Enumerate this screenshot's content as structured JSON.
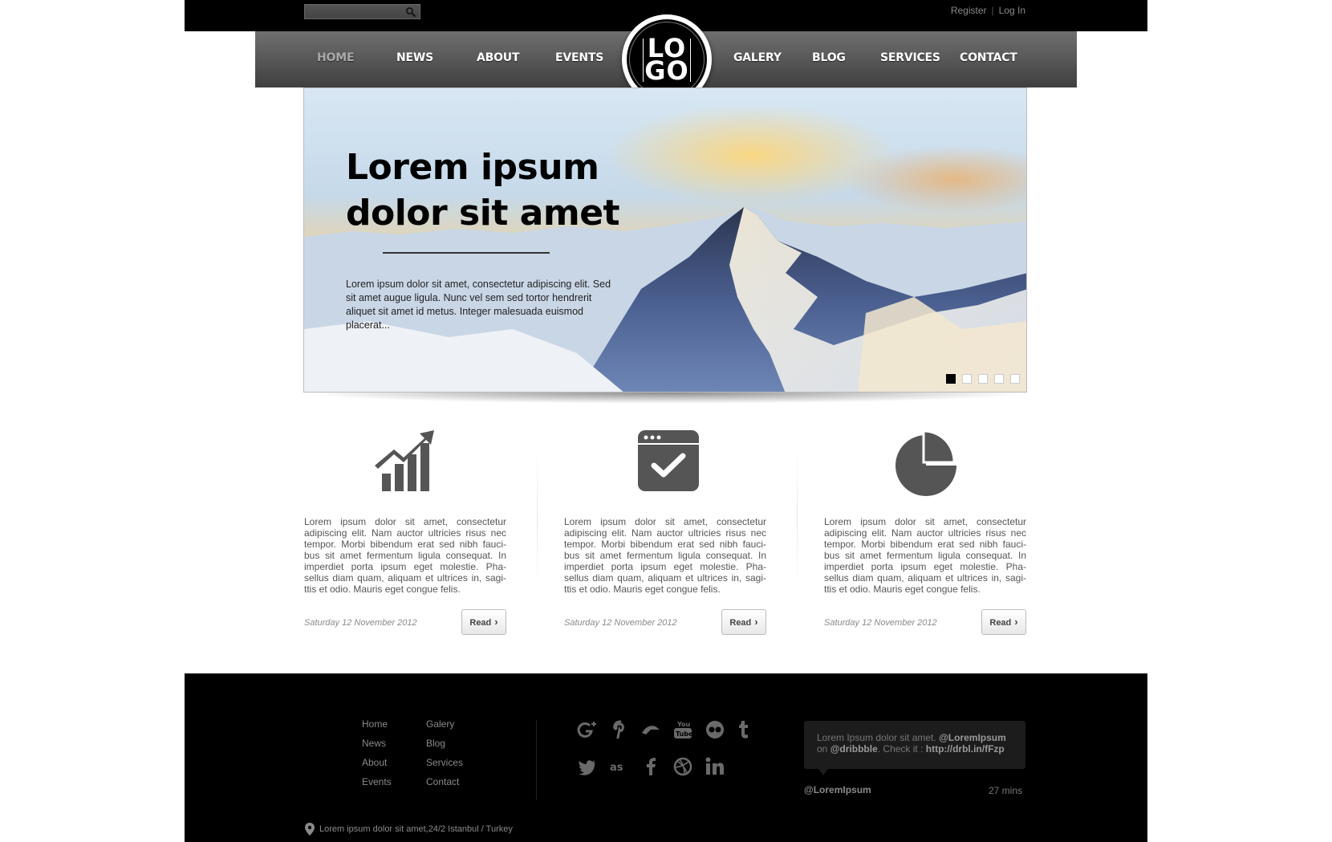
{
  "topbar": {
    "search_placeholder": "",
    "register_label": "Register",
    "separator": "|",
    "login_label": "Log In"
  },
  "nav": {
    "items": [
      {
        "label": "HOME",
        "active": true
      },
      {
        "label": "NEWS"
      },
      {
        "label": "ABOUT"
      },
      {
        "label": "EVENTS"
      },
      {
        "label": "GALERY"
      },
      {
        "label": "BLOG"
      },
      {
        "label": "SERVICES"
      },
      {
        "label": "CONTACT"
      }
    ],
    "logo_line1": "LO",
    "logo_line2": "GO"
  },
  "hero": {
    "title_line1": "Lorem ipsum",
    "title_line2": "dolor sit amet",
    "text": "Lorem ipsum dolor sit amet, consectetur adipiscing elit. Sed sit amet augue ligula. Nunc vel sem sed tortor hendrerit aliquet sit amet id metus. Integer malesuada euismod placerat...",
    "slide_count": 5,
    "active_slide": 1
  },
  "features": [
    {
      "icon": "bar-chart-growth-icon",
      "text": "Lorem ipsum dolor sit amet, consectetur adipiscing elit. Nam auctor ultricies risus nec tempor. Morbi bibendum erat sed nibh fauci-bus sit amet fermentum ligula consequat. In imperdiet porta ipsum eget molestie. Pha-sellus diam quam, aliquam et ultrices in, sagi-ttis et odio. Mauris eget congue felis.",
      "date": "Saturday 12 November 2012",
      "read_label": "Read"
    },
    {
      "icon": "browser-check-icon",
      "text": "Lorem ipsum dolor sit amet, consectetur adipiscing elit. Nam auctor ultricies risus nec tempor. Morbi bibendum erat sed nibh fauci-bus sit amet fermentum ligula consequat. In imperdiet porta ipsum eget molestie. Pha-sellus diam quam, aliquam et ultrices in, sagi-ttis et odio. Mauris eget congue felis.",
      "date": "Saturday 12 November 2012",
      "read_label": "Read"
    },
    {
      "icon": "pie-chart-icon",
      "text": "Lorem ipsum dolor sit amet, consectetur adipiscing elit. Nam auctor ultricies risus nec tempor. Morbi bibendum erat sed nibh fauci-bus sit amet fermentum ligula consequat. In imperdiet porta ipsum eget molestie. Pha-sellus diam quam, aliquam et ultrices in, sagi-ttis et odio. Mauris eget congue felis.",
      "date": "Saturday 12 November 2012",
      "read_label": "Read"
    }
  ],
  "footer": {
    "links_col1": [
      "Home",
      "News",
      "About",
      "Events"
    ],
    "links_col2": [
      "Galery",
      "Blog",
      "Services",
      "Contact"
    ],
    "social": [
      "google-plus-icon",
      "pinterest-icon",
      "deviantart-icon",
      "youtube-icon",
      "flickr-icon",
      "tumblr-icon",
      "twitter-icon",
      "lastfm-icon",
      "facebook-icon",
      "dribbble-icon",
      "linkedin-icon"
    ],
    "tweet": {
      "text_prefix": "Lorem Ipsum dolor sit amet.",
      "handle": "@LoremIpsum",
      "on": "on",
      "dribbble": "@dribbble",
      "check": ". Check it :",
      "link": "http://drbl.in/fFzp",
      "user": "@LoremIpsum",
      "time": "27 mins"
    },
    "address": "Lorem ipsum dolor sit amet,24/2  Istanbul / Turkey"
  }
}
